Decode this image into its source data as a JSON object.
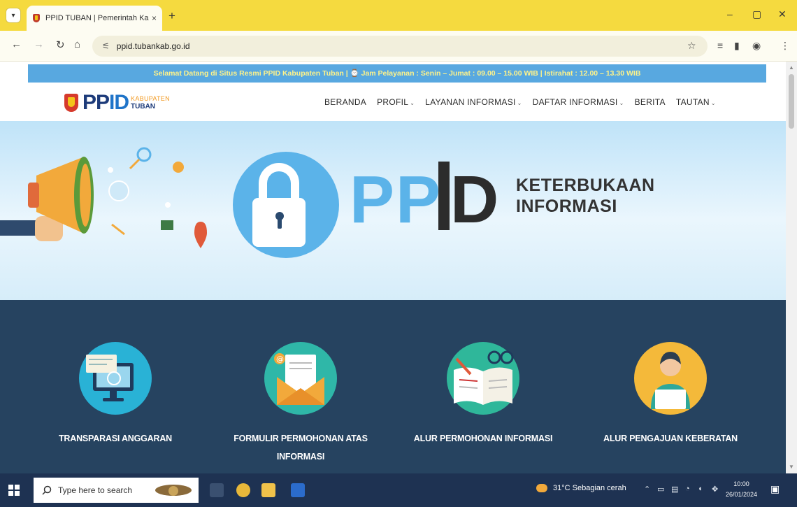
{
  "browser": {
    "tab_title": "PPID TUBAN | Pemerintah Kab...",
    "tab_close": "×",
    "new_tab": "+",
    "url": "ppid.tubankab.go.id",
    "window_controls": {
      "minimize": "–",
      "maximize": "▢",
      "close": "✕"
    },
    "icons": [
      "tab-search-icon",
      "back-icon",
      "forward-icon",
      "reload-icon",
      "home-icon",
      "site-settings-icon",
      "bookmark-star-icon",
      "reading-list-icon",
      "side-panel-icon",
      "profile-icon",
      "menu-icon"
    ]
  },
  "site": {
    "announcement": "Selamat Datang di Situs Resmi PPID Kabupaten Tuban | ⌚ Jam Pelayanan : Senin – Jumat : 09.00 – 15.00 WIB | Istirahat : 12.00 – 13.30 WIB",
    "logo": {
      "main_pp": "PP",
      "main_id": "ID",
      "sub1": "KABUPATEN",
      "sub2": "TUBAN"
    },
    "nav": [
      {
        "label": "BERANDA",
        "has_dropdown": false
      },
      {
        "label": "PROFIL",
        "has_dropdown": true
      },
      {
        "label": "LAYANAN INFORMASI",
        "has_dropdown": true
      },
      {
        "label": "DAFTAR INFORMASI",
        "has_dropdown": true
      },
      {
        "label": "BERITA",
        "has_dropdown": false
      },
      {
        "label": "TAUTAN",
        "has_dropdown": true
      }
    ],
    "hero": {
      "pp": "PP",
      "d": "D",
      "tagline_line1": "KETERBUKAAN",
      "tagline_line2": "INFORMASI"
    },
    "features": [
      {
        "label": "TRANSPARASI ANGGARAN",
        "icon": "computer-budget-icon"
      },
      {
        "label": "FORMULIR PERMOHONAN ATAS INFORMASI",
        "icon": "envelope-form-icon"
      },
      {
        "label": "ALUR PERMOHONAN INFORMASI",
        "icon": "open-book-icon"
      },
      {
        "label": "ALUR PENGAJUAN KEBERATAN",
        "icon": "person-laptop-icon"
      }
    ],
    "colors": {
      "announce_bg": "#58a8e0",
      "features_bg": "#264360",
      "hero_blue": "#5bb3e9",
      "tab_strip": "#f5da3f"
    }
  },
  "taskbar": {
    "search_placeholder": "Type here to search",
    "weather": "31°C  Sebagian cerah",
    "time": "10:00",
    "date": "26/01/2024"
  }
}
